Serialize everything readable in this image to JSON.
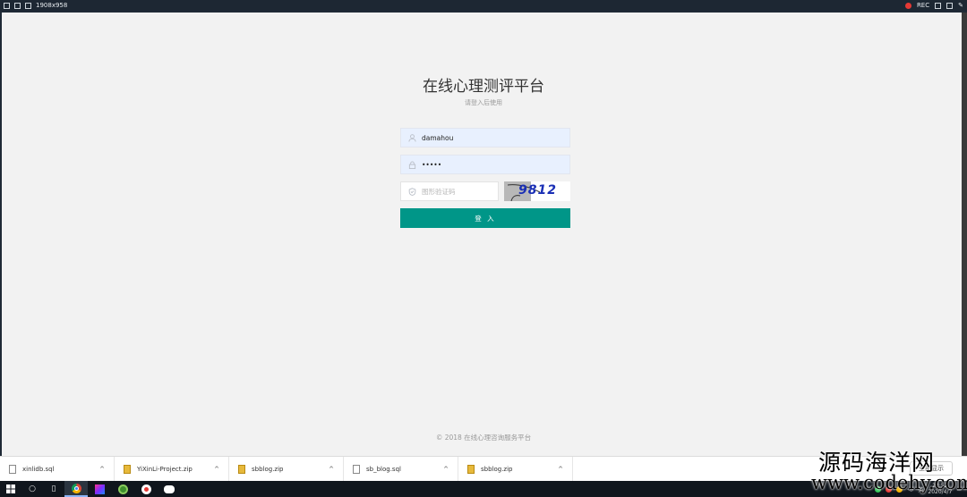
{
  "recorder": {
    "resolution": "1908x958",
    "rec_label": "REC"
  },
  "login": {
    "title": "在线心理测评平台",
    "subtitle": "请登入后使用",
    "username_value": "damahou",
    "password_value": "•••••",
    "captcha_placeholder": "图形验证码",
    "captcha_code": "9812",
    "submit_label": "登 入"
  },
  "footer": {
    "text": "© 2018  在线心理咨询服务平台"
  },
  "downloads": {
    "items": [
      {
        "name": "xinlidb.sql",
        "type": "file"
      },
      {
        "name": "YiXinLi-Project.zip",
        "type": "zip"
      },
      {
        "name": "sbblog.zip",
        "type": "zip"
      },
      {
        "name": "sb_blog.sql",
        "type": "file"
      },
      {
        "name": "sbblog.zip",
        "type": "zip"
      }
    ],
    "show_all_label": "全部显示"
  },
  "taskbar": {
    "time": "22:52",
    "date": "2020/4/7",
    "ime_label": "英"
  },
  "watermark": {
    "cn": "源码海洋网",
    "en": "www.codehy.com"
  },
  "colors": {
    "primary_button": "#009688",
    "autofill_bg": "#e8f0fe",
    "page_bg": "#f2f2f2"
  }
}
